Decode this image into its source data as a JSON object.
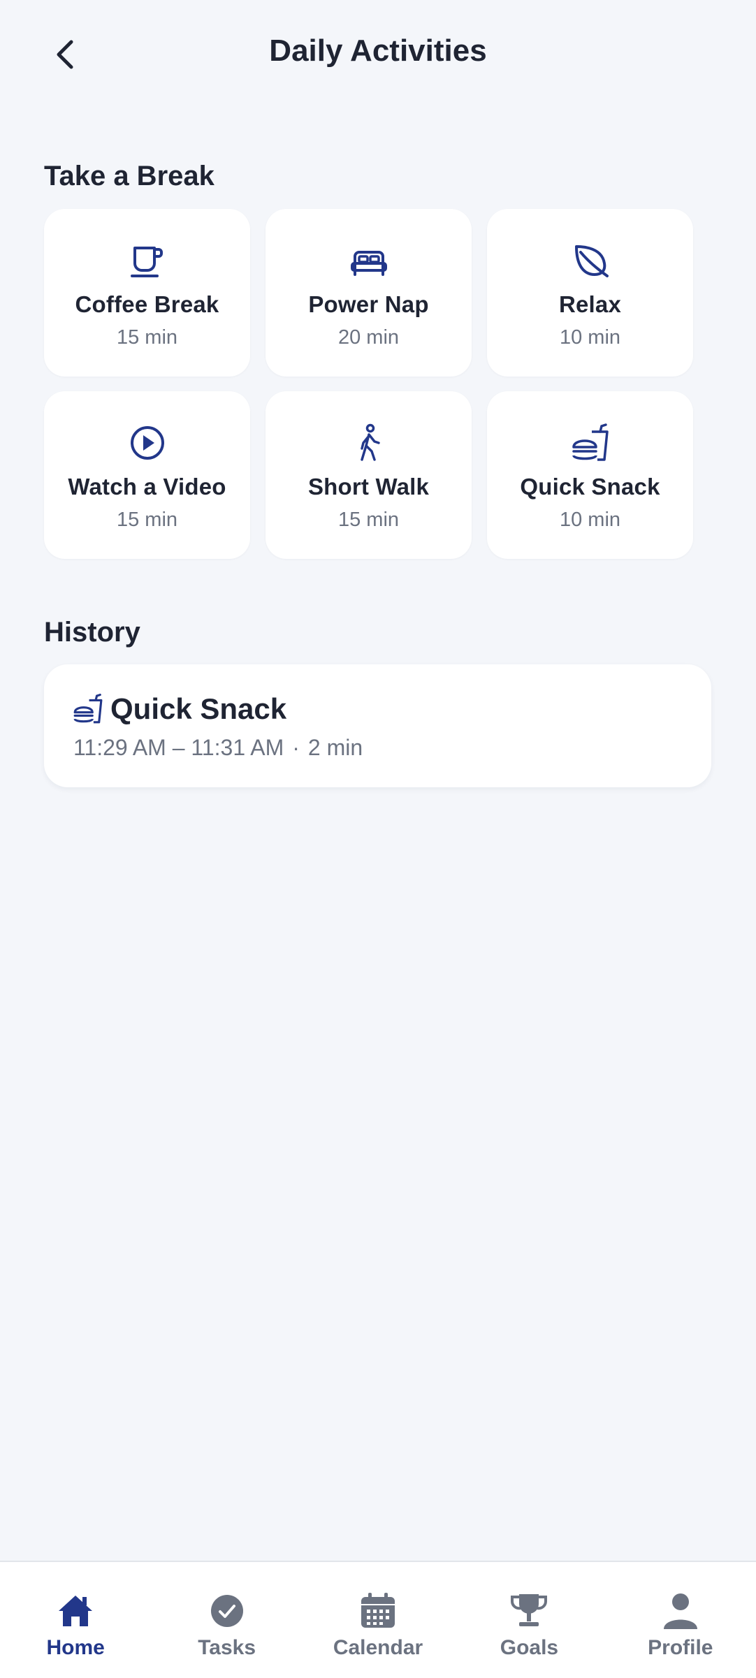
{
  "header": {
    "title": "Daily Activities"
  },
  "break_section": {
    "title": "Take a Break",
    "activities": [
      {
        "name": "Coffee Break",
        "duration": "15 min",
        "icon": "coffee-cup-icon"
      },
      {
        "name": "Power Nap",
        "duration": "20 min",
        "icon": "bed-icon"
      },
      {
        "name": "Relax",
        "duration": "10 min",
        "icon": "leaf-icon"
      },
      {
        "name": "Watch a Video",
        "duration": "15 min",
        "icon": "play-circle-icon"
      },
      {
        "name": "Short Walk",
        "duration": "15 min",
        "icon": "walking-person-icon"
      },
      {
        "name": "Quick Snack",
        "duration": "10 min",
        "icon": "fast-food-icon"
      }
    ]
  },
  "history": {
    "title": "History",
    "items": [
      {
        "name": "Quick Snack",
        "time_range": "11:29 AM – 11:31 AM",
        "separator": "·",
        "duration": "2 min",
        "icon": "fast-food-icon"
      }
    ]
  },
  "nav": {
    "items": [
      {
        "label": "Home",
        "icon": "home-icon",
        "active": true
      },
      {
        "label": "Tasks",
        "icon": "check-circle-icon",
        "active": false
      },
      {
        "label": "Calendar",
        "icon": "calendar-icon",
        "active": false
      },
      {
        "label": "Goals",
        "icon": "trophy-icon",
        "active": false
      },
      {
        "label": "Profile",
        "icon": "person-icon",
        "active": false
      }
    ]
  },
  "colors": {
    "accent": "#22378a",
    "muted": "#6b7280",
    "background": "#f4f6fa",
    "card": "#ffffff",
    "text": "#1f2433"
  }
}
